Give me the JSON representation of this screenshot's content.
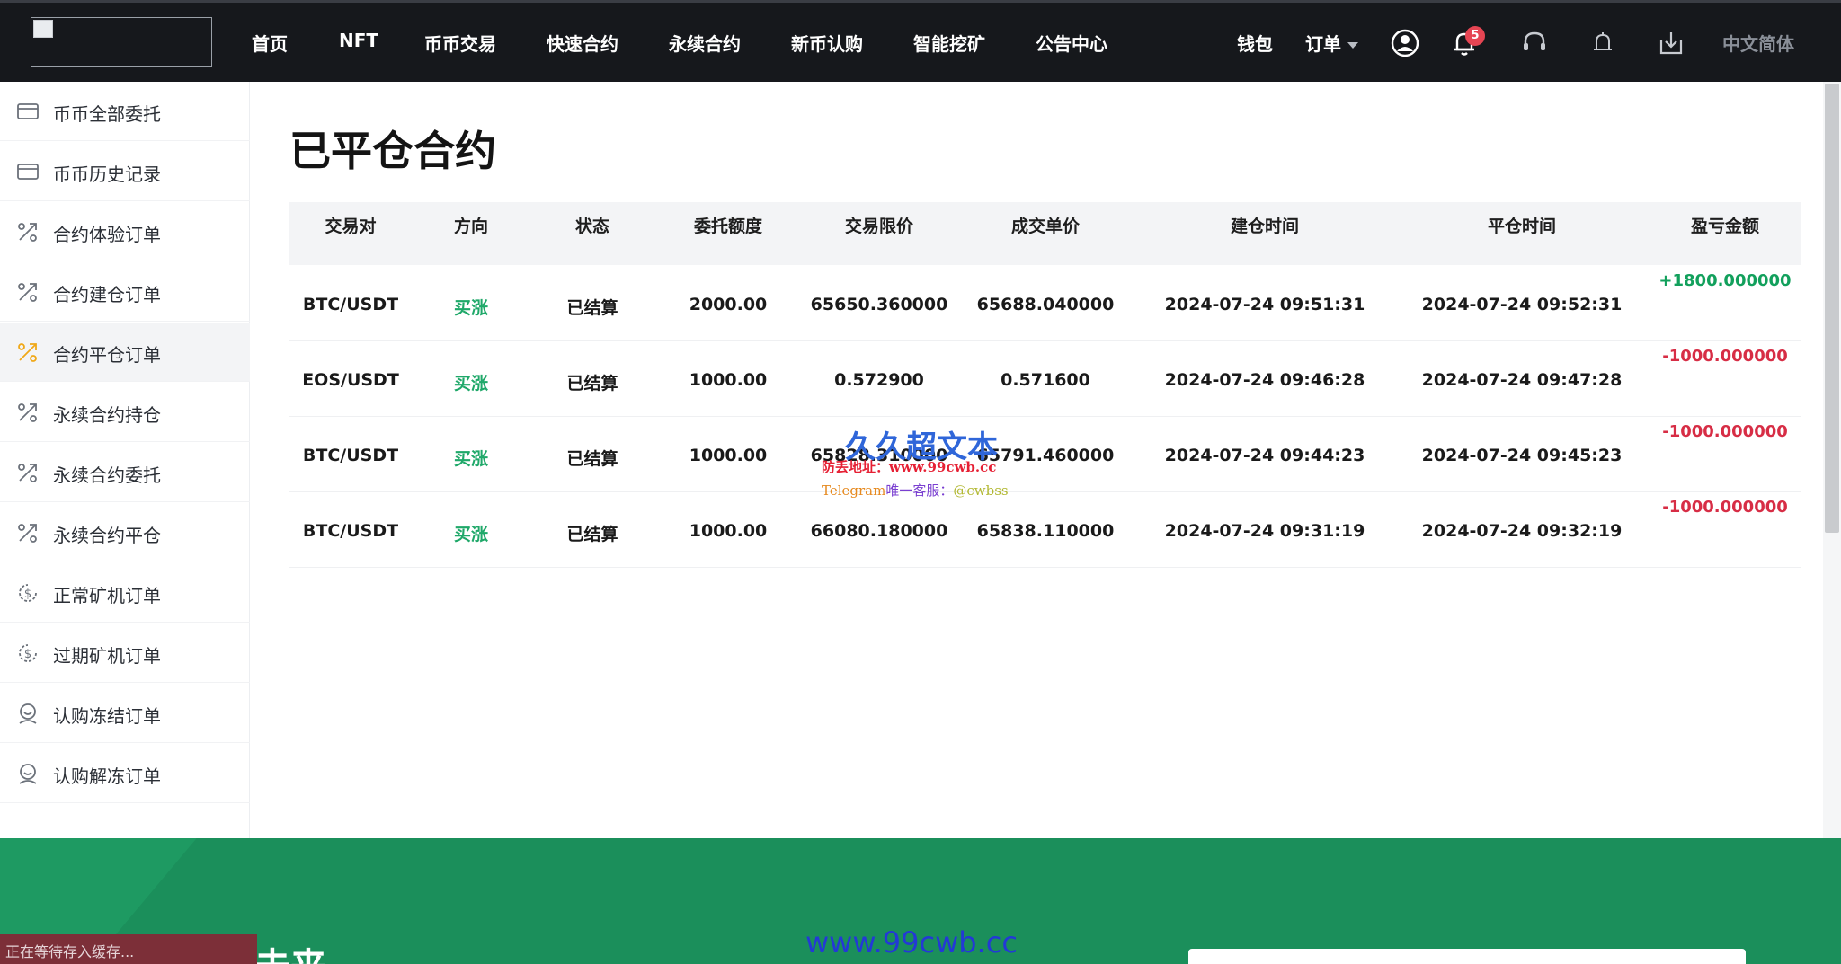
{
  "nav": {
    "items": [
      "首页",
      "NFT",
      "币币交易",
      "快速合约",
      "永续合约",
      "新币认购",
      "智能挖矿",
      "公告中心"
    ],
    "wallet": "钱包",
    "orders": "订单",
    "notification_count": "5",
    "language": "中文简体",
    "icons": [
      "user-icon",
      "bell-icon",
      "headset-icon",
      "bell-outline-icon",
      "download-icon"
    ]
  },
  "sidebar": {
    "items": [
      {
        "label": "币币全部委托",
        "icon": "wallet-icon"
      },
      {
        "label": "币币历史记录",
        "icon": "wallet-icon"
      },
      {
        "label": "合约体验订单",
        "icon": "percent-icon"
      },
      {
        "label": "合约建仓订单",
        "icon": "percent-icon"
      },
      {
        "label": "合约平仓订单",
        "icon": "percent-icon"
      },
      {
        "label": "永续合约持仓",
        "icon": "percent-icon"
      },
      {
        "label": "永续合约委托",
        "icon": "percent-icon"
      },
      {
        "label": "永续合约平仓",
        "icon": "percent-icon"
      },
      {
        "label": "正常矿机订单",
        "icon": "dollar-cycle-icon"
      },
      {
        "label": "过期矿机订单",
        "icon": "dollar-cycle-icon"
      },
      {
        "label": "认购冻结订单",
        "icon": "face-icon"
      },
      {
        "label": "认购解冻订单",
        "icon": "face-icon"
      }
    ],
    "active_index": 4,
    "active_color": "#f0a818"
  },
  "main": {
    "title": "已平仓合约",
    "columns": [
      "交易对",
      "方向",
      "状态",
      "委托额度",
      "交易限价",
      "成交单价",
      "建仓时间",
      "平仓时间",
      "盈亏金额"
    ],
    "rows": [
      {
        "pair": "BTC/USDT",
        "direction": "买涨",
        "status": "已结算",
        "amount": "2000.00",
        "limit_price": "65650.360000",
        "deal_price": "65688.040000",
        "open_time": "2024-07-24 09:51:31",
        "close_time": "2024-07-24 09:52:31",
        "pnl": "+1800.000000",
        "pnl_sign": "pos"
      },
      {
        "pair": "EOS/USDT",
        "direction": "买涨",
        "status": "已结算",
        "amount": "1000.00",
        "limit_price": "0.572900",
        "deal_price": "0.571600",
        "open_time": "2024-07-24 09:46:28",
        "close_time": "2024-07-24 09:47:28",
        "pnl": "-1000.000000",
        "pnl_sign": "neg"
      },
      {
        "pair": "BTC/USDT",
        "direction": "买涨",
        "status": "已结算",
        "amount": "1000.00",
        "limit_price": "65828.310000",
        "deal_price": "65791.460000",
        "open_time": "2024-07-24 09:44:23",
        "close_time": "2024-07-24 09:45:23",
        "pnl": "-1000.000000",
        "pnl_sign": "neg"
      },
      {
        "pair": "BTC/USDT",
        "direction": "买涨",
        "status": "已结算",
        "amount": "1000.00",
        "limit_price": "66080.180000",
        "deal_price": "65838.110000",
        "open_time": "2024-07-24 09:31:19",
        "close_time": "2024-07-24 09:32:19",
        "pnl": "-1000.000000",
        "pnl_sign": "neg"
      }
    ]
  },
  "watermark": {
    "title": "久久超文本",
    "line2": "防丢地址：www.99cwb.cc",
    "line3_a": "Telegram",
    "line3_b": "唯一客服：",
    "line3_c": "@cwbss"
  },
  "footer": {
    "heading": "未来",
    "status": "正在等待存入缓存...",
    "url": "www.99cwb.cc"
  },
  "colors": {
    "nav_bg": "#16181c",
    "positive": "#12a05c",
    "negative": "#d72d45",
    "direction": "#1fa869",
    "footer_bg": "#1b8f5b"
  }
}
